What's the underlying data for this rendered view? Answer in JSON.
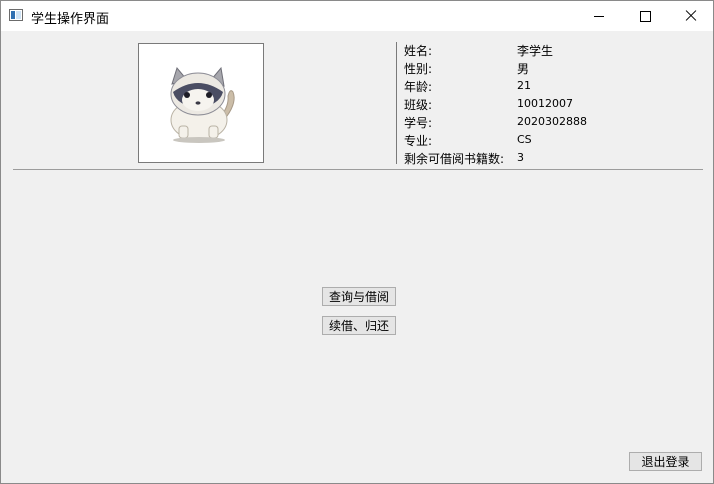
{
  "window": {
    "title": "学生操作界面"
  },
  "student": {
    "fields": [
      {
        "label": "姓名:",
        "value": "李学生"
      },
      {
        "label": "性别:",
        "value": "男"
      },
      {
        "label": "年龄:",
        "value": "21"
      },
      {
        "label": "班级:",
        "value": "10012007"
      },
      {
        "label": "学号:",
        "value": "2020302888"
      },
      {
        "label": "专业:",
        "value": "CS"
      },
      {
        "label": "剩余可借阅书籍数:",
        "value": "3"
      }
    ]
  },
  "actions": {
    "query_borrow": "查询与借阅",
    "renew_return": "续借、归还",
    "logout": "退出登录"
  }
}
